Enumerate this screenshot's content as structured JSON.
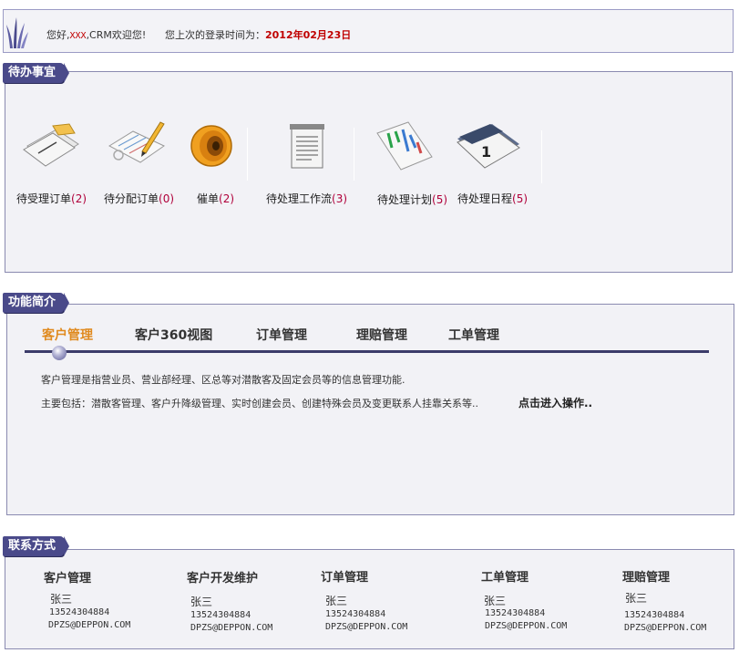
{
  "welcome": {
    "greeting_prefix": "您好,",
    "user": "XXX",
    "greeting_suffix": ",CRM欢迎您!",
    "last_login_label": "您上次的登录时间为：",
    "last_login_date": "2012年02月23日"
  },
  "todo": {
    "title": "待办事宜",
    "items": [
      {
        "label": "待受理订单",
        "count": "(2)",
        "icon": "papers-icon"
      },
      {
        "label": "待分配订单",
        "count": "(0)",
        "icon": "form-pencil-icon"
      },
      {
        "label": "催单",
        "count": "(2)",
        "icon": "speaker-icon"
      },
      {
        "label": "待处理工作流",
        "count": "(3)",
        "icon": "document-icon"
      },
      {
        "label": "待处理计划",
        "count": "(5)",
        "icon": "chart-plan-icon"
      },
      {
        "label": "待处理日程",
        "count": "(5)",
        "icon": "calendar-icon"
      }
    ]
  },
  "features": {
    "title": "功能简介",
    "tabs": [
      "客户管理",
      "客户360视图",
      "订单管理",
      "理赔管理",
      "工单管理"
    ],
    "active_tab": "客户管理",
    "desc_line1": "客户管理是指营业员、营业部经理、区总等对潜散客及固定会员等的信息管理功能.",
    "desc_line2": "主要包括：潜散客管理、客户升降级管理、实时创建会员、创建特殊会员及变更联系人挂靠关系等..",
    "enter_link": "点击进入操作.."
  },
  "contacts": {
    "title": "联系方式",
    "columns": [
      {
        "title": "客户管理",
        "name": "张三",
        "phone": "13524304884",
        "email": "DPZS@DEPPON.COM"
      },
      {
        "title": "客户开发维护",
        "name": "张三",
        "phone": "13524304884",
        "email": "DPZS@DEPPON.COM"
      },
      {
        "title": "订单管理",
        "name": "张三",
        "phone": "13524304884",
        "email": "DPZS@DEPPON.COM"
      },
      {
        "title": "工单管理",
        "name": "张三",
        "phone": "13524304884",
        "email": "DPZS@DEPPON.COM"
      },
      {
        "title": "理赔管理",
        "name": "张三",
        "phone": "13524304884",
        "email": "DPZS@DEPPON.COM"
      }
    ]
  }
}
